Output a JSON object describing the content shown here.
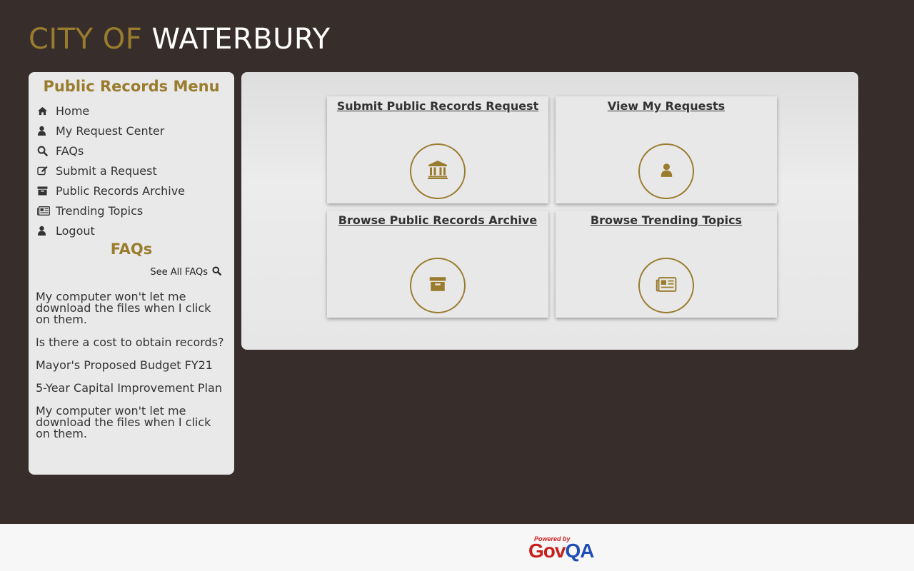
{
  "header": {
    "city": "CITY OF",
    "name": "WATERBURY"
  },
  "sidebar": {
    "menu_title": "Public Records Menu",
    "items": [
      {
        "label": "Home",
        "icon": "home-icon"
      },
      {
        "label": "My Request Center",
        "icon": "user-icon"
      },
      {
        "label": "FAQs",
        "icon": "search-icon"
      },
      {
        "label": "Submit a Request",
        "icon": "edit-icon"
      },
      {
        "label": "Public Records Archive",
        "icon": "archive-icon"
      },
      {
        "label": "Trending Topics",
        "icon": "newspaper-icon"
      },
      {
        "label": "Logout",
        "icon": "user-icon"
      }
    ],
    "faq_title": "FAQs",
    "see_all": "See All FAQs",
    "faqs": [
      "My computer won't let me download the files when I click on them.",
      "Is there a cost to obtain records?",
      "Mayor's Proposed Budget FY21",
      "5-Year Capital Improvement Plan",
      "My computer won't let me download the files when I click on them."
    ]
  },
  "tiles": [
    {
      "label": "Submit Public Records Request",
      "icon": "bank-icon"
    },
    {
      "label": "View My Requests",
      "icon": "user-icon"
    },
    {
      "label": "Browse Public Records Archive",
      "icon": "archive-icon"
    },
    {
      "label": "Browse Trending Topics",
      "icon": "newspaper-icon"
    }
  ],
  "footer": {
    "powered_by": "Powered by",
    "brand_gov": "Gov",
    "brand_qa": "QA"
  },
  "colors": {
    "background": "#372d2b",
    "accent": "#9a7c2e",
    "panel": "#e9e9e9"
  }
}
